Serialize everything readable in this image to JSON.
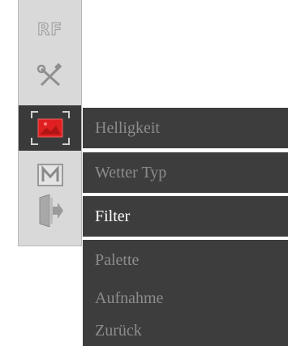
{
  "toolbar": {
    "rf_label": "RF",
    "tools": [
      {
        "name": "rf",
        "icon": "rf-text-icon"
      },
      {
        "name": "tools",
        "icon": "wrench-screwdriver-icon"
      },
      {
        "name": "image",
        "icon": "image-adjust-icon",
        "active": true
      },
      {
        "name": "mode",
        "icon": "m-icon"
      },
      {
        "name": "exit",
        "icon": "exit-door-icon"
      }
    ]
  },
  "menu": {
    "items": [
      {
        "label": "Helligkeit"
      },
      {
        "label": "Wetter Typ"
      },
      {
        "label": "Filter",
        "selected": true
      },
      {
        "label": "Palette"
      },
      {
        "label": "Aufnahme"
      },
      {
        "label": "Zurück"
      }
    ]
  },
  "colors": {
    "toolbar_bg": "#d9d9d9",
    "menu_bg": "#3d3d3d",
    "menu_text": "#8c8c8c",
    "menu_text_selected": "#ffffff",
    "accent_red": "#e02020"
  }
}
